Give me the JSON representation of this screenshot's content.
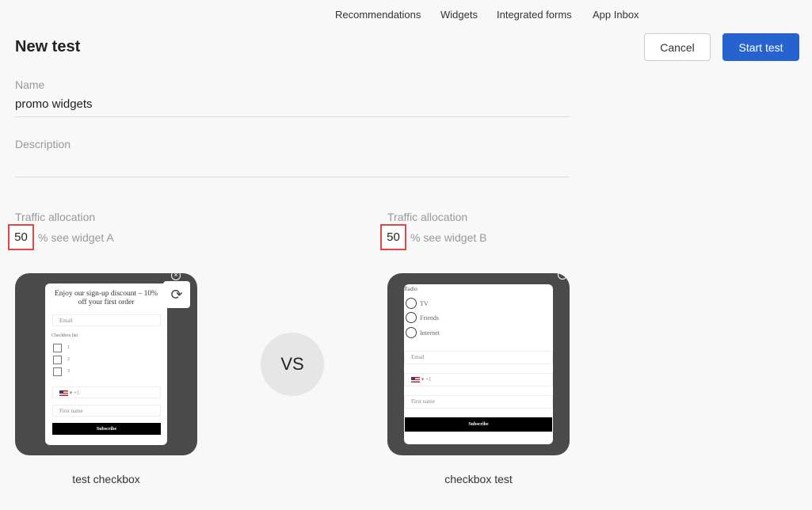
{
  "nav": [
    "Recommendations",
    "Widgets",
    "Integrated forms",
    "App Inbox"
  ],
  "title": "New test",
  "buttons": {
    "cancel": "Cancel",
    "start": "Start test"
  },
  "colors": {
    "primary": "#2763cf",
    "highlight": "#e04848"
  },
  "form": {
    "name_label": "Name",
    "name_value": "promo widgets",
    "description_label": "Description",
    "description_value": ""
  },
  "variant_a": {
    "traffic_label": "Traffic allocation",
    "traffic_value": "50",
    "traffic_suffix": "% see widget A",
    "widget_name": "test checkbox",
    "preview": {
      "heading": "Enjoy our sign-up discount – 10% off your first order",
      "email": "Email",
      "checkbox_label": "Checkbox list",
      "options": [
        "1",
        "2",
        "3"
      ],
      "phone": "+1",
      "first_name": "First name",
      "subscribe": "Subscribe"
    }
  },
  "vs": "VS",
  "variant_b": {
    "traffic_label": "Traffic allocation",
    "traffic_value": "50",
    "traffic_suffix": "% see widget B",
    "widget_name": "checkbox test",
    "preview": {
      "radio_label": "Radio",
      "options": [
        "TV",
        "Friends",
        "Internet"
      ],
      "email": "Email",
      "phone": "+1",
      "first_name": "First name",
      "subscribe": "Subscribe"
    }
  }
}
